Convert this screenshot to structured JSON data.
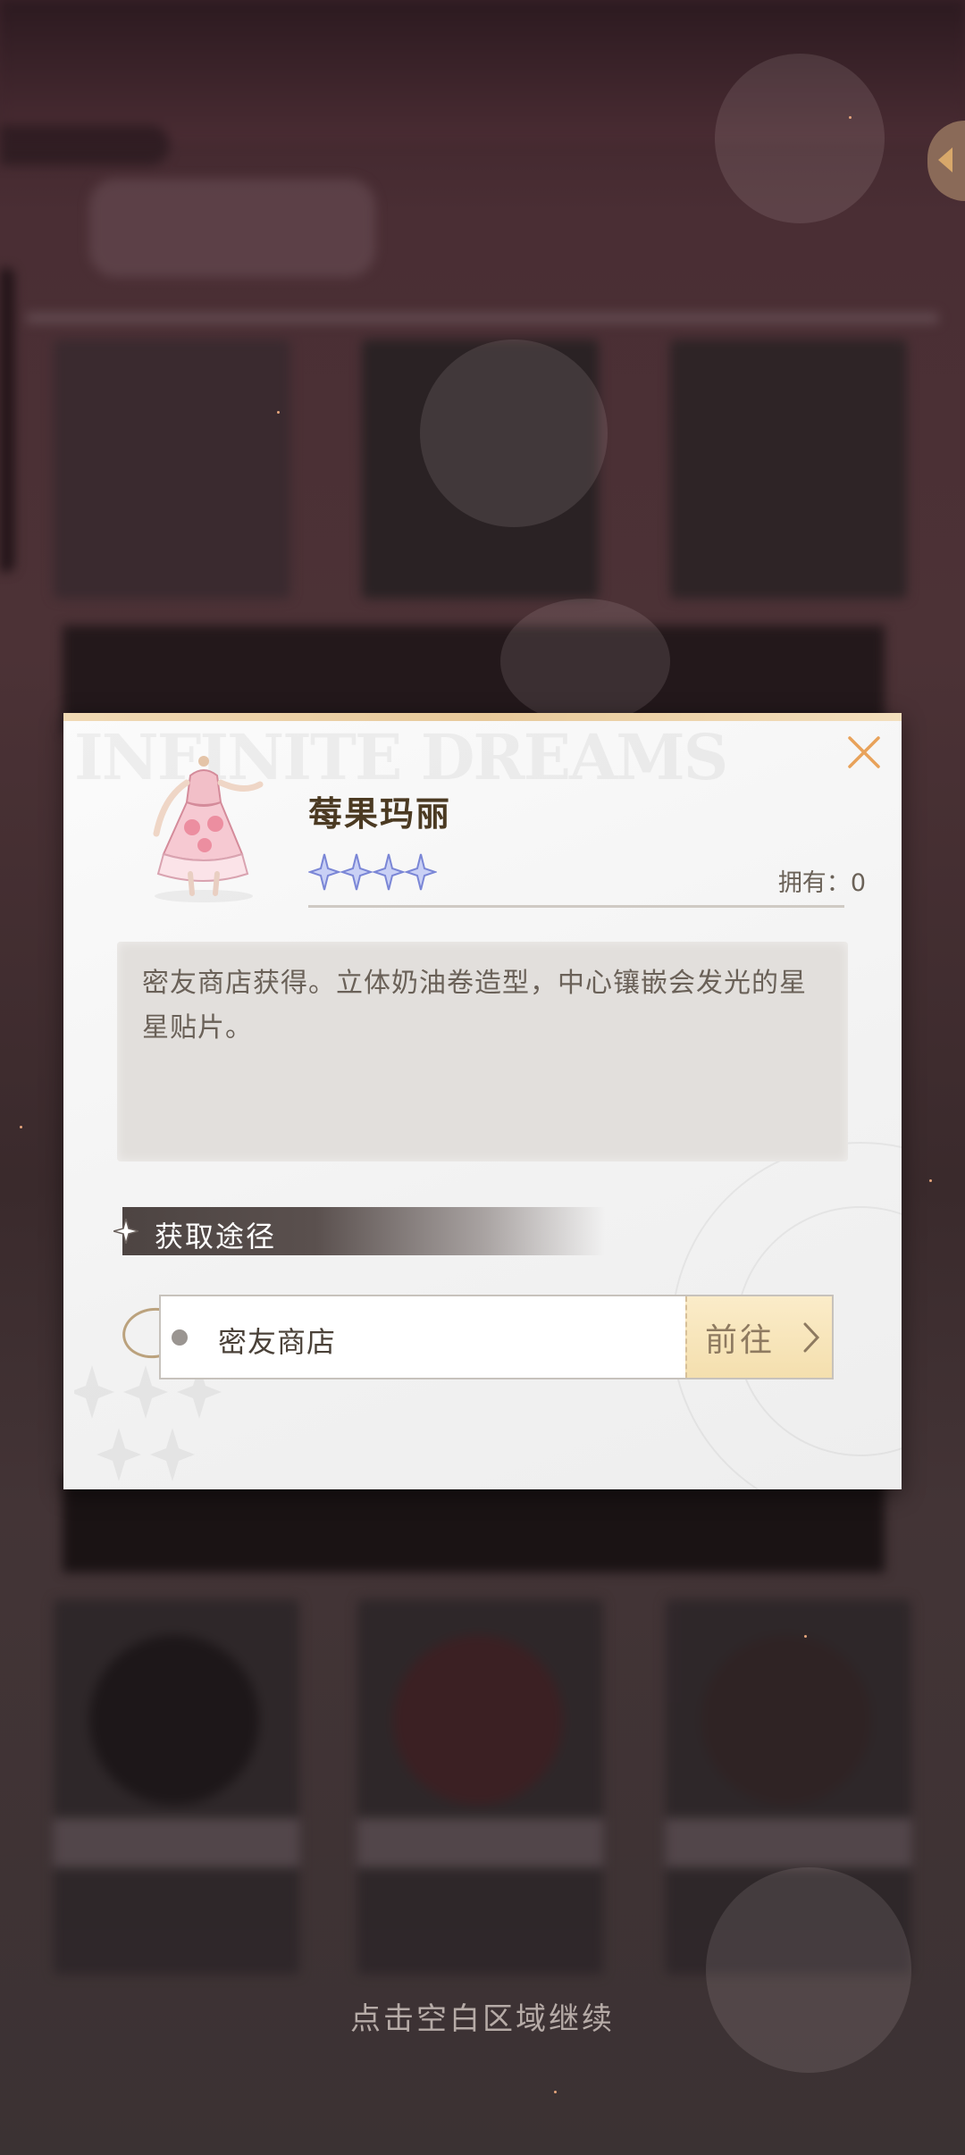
{
  "dialog": {
    "item_name": "莓果玛丽",
    "rarity_stars": 4,
    "owned_label": "拥有：",
    "owned_count": "0",
    "description": "密友商店获得。立体奶油卷造型，中心镶嵌会发光的星星贴片。",
    "watermark": "INFINITE DREAMS",
    "section_title": "获取途径",
    "routes": [
      {
        "label": "密友商店",
        "button_label": "前往"
      }
    ]
  },
  "footer": {
    "continue_hint": "点击空白区域继续"
  },
  "colors": {
    "accent_gold": "#e8a25a",
    "star_blue": "#7a86d6",
    "overlay": "#3a2a2c"
  },
  "icons": [
    "close-icon",
    "star-icon",
    "diamond-sparkle-icon",
    "chevron-right-icon",
    "back-arrow-icon"
  ]
}
